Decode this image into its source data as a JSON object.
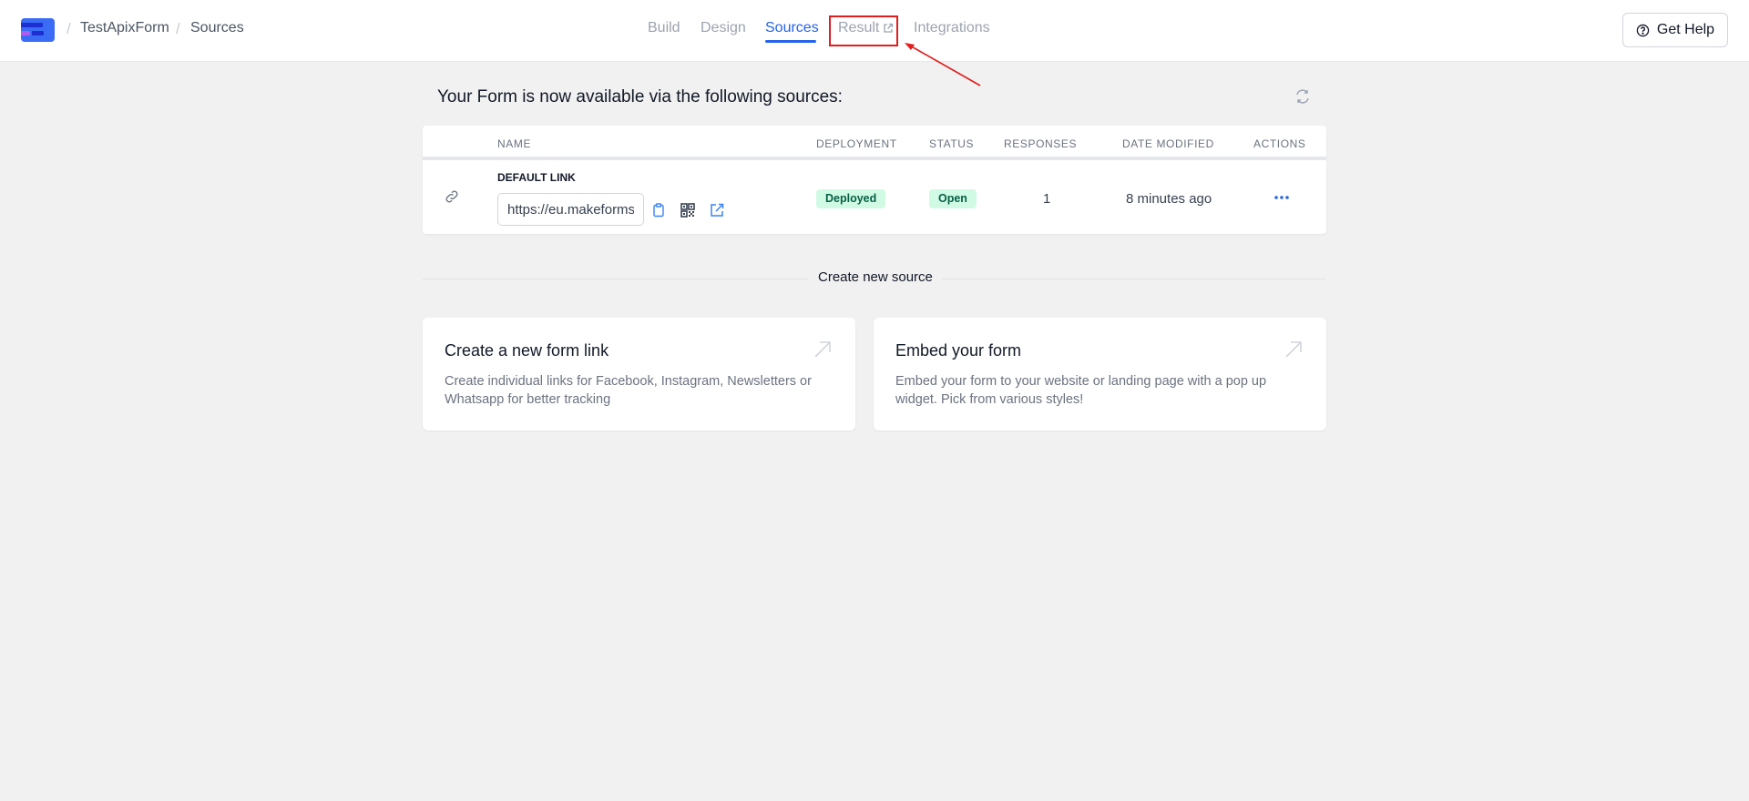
{
  "breadcrumb": {
    "project": "TestApixForm",
    "page": "Sources"
  },
  "tabs": [
    {
      "label": "Build"
    },
    {
      "label": "Design"
    },
    {
      "label": "Sources"
    },
    {
      "label": "Result"
    },
    {
      "label": "Integrations"
    }
  ],
  "help_button": {
    "label": "Get Help"
  },
  "sources": {
    "heading": "Your Form is now available via the following sources:",
    "columns": [
      "NAME",
      "DEPLOYMENT",
      "STATUS",
      "RESPONSES",
      "DATE MODIFIED",
      "ACTIONS"
    ],
    "rows": [
      {
        "label": "DEFAULT LINK",
        "url": "https://eu.makeforms.io",
        "deployment": "Deployed",
        "status": "Open",
        "responses": "1",
        "date_modified": "8 minutes ago"
      }
    ]
  },
  "create_divider": "Create new source",
  "cards": [
    {
      "title": "Create a new form link",
      "desc_line1": "Create individual links for Facebook, Instagram, Newsletters or",
      "desc_line2": "Whatsapp for better tracking"
    },
    {
      "title": "Embed your form",
      "desc_line1": "Embed your form to your website or landing page with a pop up",
      "desc_line2": "widget. Pick from various styles!"
    }
  ],
  "colors": {
    "accent": "#2563eb",
    "badge_bg": "#d1fae5",
    "badge_text": "#065f46",
    "annotation": "#e11d1d"
  }
}
